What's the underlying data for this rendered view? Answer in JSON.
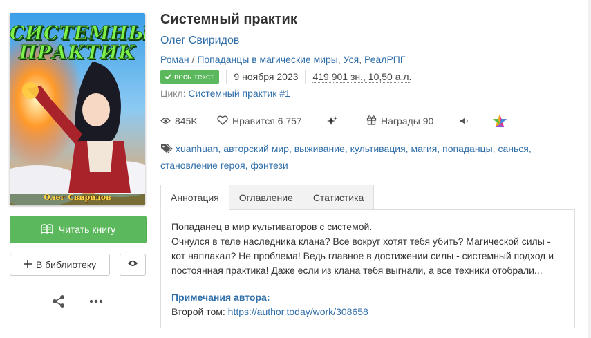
{
  "book": {
    "title": "Системный практик",
    "author": "Олег Свиридов",
    "genres": [
      "Роман",
      "Попаданцы в магические миры",
      "Уся",
      "РеалРПГ"
    ],
    "genre_sep": " / ",
    "status_badge": "весь текст",
    "date": "9 ноября 2023",
    "size": "419 901 зн., 10,50 а.л.",
    "cycle_label": "Цикл:",
    "cycle_name": "Системный практик #1"
  },
  "cover": {
    "title_line1": "СИСТЕМНЫЙ",
    "title_line2": "ПРАКТИК",
    "author": "Олег Свиридов"
  },
  "stats": {
    "views": "845K",
    "likes": "Нравится 6 757",
    "awards": "Награды 90"
  },
  "tags": [
    "xuanhuan",
    "авторский мир",
    "выживание",
    "культивация",
    "магия",
    "попаданцы",
    "санься",
    "становление героя",
    "фэнтези"
  ],
  "actions": {
    "read": "Читать книгу",
    "library": "В библиотеку"
  },
  "tabs": [
    {
      "label": "Аннотация",
      "active": true
    },
    {
      "label": "Оглавление",
      "active": false
    },
    {
      "label": "Статистика",
      "active": false
    }
  ],
  "annotation": {
    "line1": "Попаданец в мир культиваторов с системой.",
    "line2": "Очнулся в теле наследника клана? Все вокруг хотят тебя убить? Магической силы - кот наплакал? Не проблема! Ведь главное в достижении силы - системный подход и постоянная практика! Даже если из клана тебя выгнали, а все техники отобрали...",
    "notes_heading": "Примечания автора:",
    "notes_label": "Второй том:",
    "notes_link": "https://author.today/work/308658"
  },
  "colors": {
    "accent": "#2f6ea8",
    "success": "#5cb85c"
  },
  "icons": [
    "eye-icon",
    "heart-icon",
    "sparkle-icon",
    "gift-icon",
    "volume-icon",
    "star-icon",
    "tag-icon",
    "book-icon",
    "plus-icon",
    "share-icon",
    "more-icon",
    "check-icon"
  ]
}
